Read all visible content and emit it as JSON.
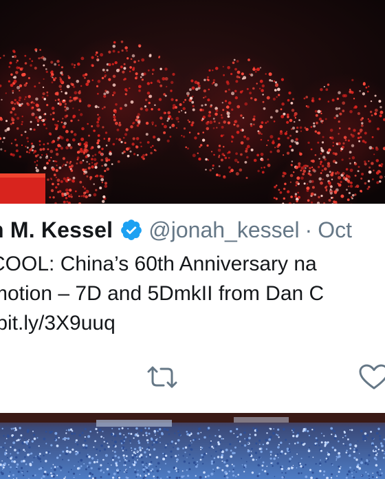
{
  "tweet": {
    "author_name": "h M. Kessel",
    "handle": "@jonah_kessel",
    "separator": "·",
    "date": "Oct",
    "text_lines": [
      "COOL: China’s 60th Anniversary na",
      "motion – 7D and 5DmkII from Dan C",
      "/bit.ly/3X9uuq"
    ]
  },
  "icons": {
    "verified": "verified-badge-icon",
    "retweet": "retweet-icon",
    "like": "heart-icon"
  },
  "colors": {
    "verified_blue": "#1da1f2",
    "text": "#14171a",
    "secondary_text": "#657786",
    "firework_red": "#ff3b30"
  }
}
